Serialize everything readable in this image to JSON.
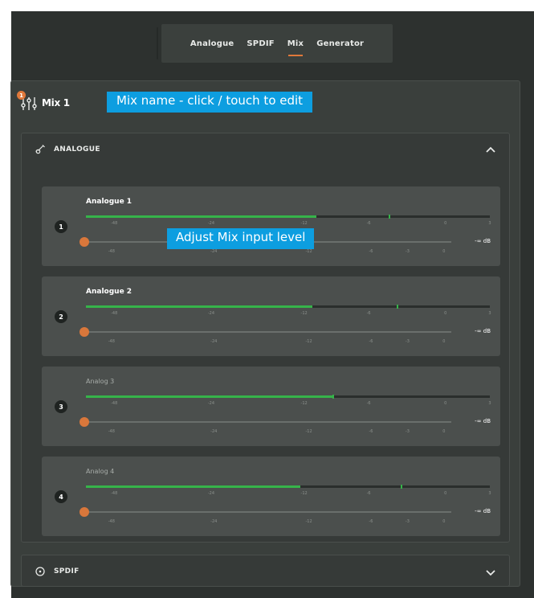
{
  "tabs": [
    {
      "label": "Analogue",
      "active": false
    },
    {
      "label": "SPDIF",
      "active": false
    },
    {
      "label": "Mix",
      "active": true
    },
    {
      "label": "Generator",
      "active": false
    }
  ],
  "mix": {
    "badge": "1",
    "name": "Mix 1",
    "name_tooltip": "Mix name - click / touch to edit"
  },
  "level_tooltip": "Adjust Mix input level",
  "groups": {
    "analogue": {
      "label": "ANALOGUE",
      "icon": "guitar-icon",
      "expanded": true
    },
    "spdif": {
      "label": "SPDIF",
      "icon": "circle-icon",
      "expanded": false
    }
  },
  "meter_scale": [
    "-48",
    "-24",
    "-12",
    "-6",
    "0",
    "3"
  ],
  "fader_scale": [
    "-48",
    "-24",
    "-12",
    "-6",
    "-3",
    "0"
  ],
  "channels": [
    {
      "number": "1",
      "name": "Analogue 1",
      "level": "-∞ dB",
      "meter_level": 0.57,
      "peak_level": 0.75
    },
    {
      "number": "2",
      "name": "Analogue 2",
      "level": "-∞ dB",
      "meter_level": 0.56,
      "peak_level": 0.77
    },
    {
      "number": "3",
      "name": "Analog 3",
      "level": "-∞ dB",
      "meter_level": 0.61,
      "peak_level": 0.61
    },
    {
      "number": "4",
      "name": "Analog 4",
      "level": "-∞ dB",
      "meter_level": 0.53,
      "peak_level": 0.78
    }
  ],
  "colors": {
    "accent": "#e0783a",
    "meter_green": "#36b44a",
    "tooltip_blue": "#0d9ee0"
  }
}
